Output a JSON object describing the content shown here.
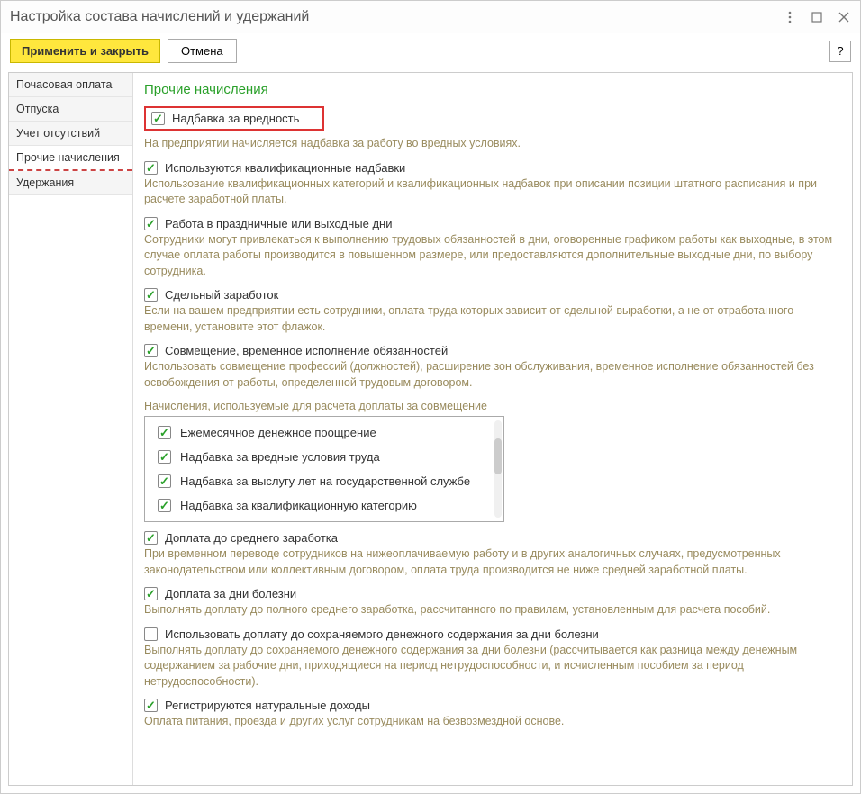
{
  "title": "Настройка состава начислений и удержаний",
  "toolbar": {
    "apply_close": "Применить и закрыть",
    "cancel": "Отмена",
    "help": "?"
  },
  "sidebar": {
    "items": [
      {
        "label": "Почасовая оплата"
      },
      {
        "label": "Отпуска"
      },
      {
        "label": "Учет отсутствий"
      },
      {
        "label": "Прочие начисления"
      },
      {
        "label": "Удержания"
      }
    ]
  },
  "section": {
    "title": "Прочие начисления"
  },
  "checks": {
    "hazard": {
      "label": "Надбавка за вредность",
      "checked": true
    },
    "hazard_desc": "На предприятии начисляется надбавка за работу во вредных условиях.",
    "qual": {
      "label": "Используются квалификационные надбавки",
      "checked": true
    },
    "qual_desc": "Использование квалификационных категорий и квалификационных надбавок при описании позиции штатного расписания и при расчете заработной платы.",
    "holiday": {
      "label": "Работа в праздничные или выходные дни",
      "checked": true
    },
    "holiday_desc": "Сотрудники могут привлекаться к выполнению трудовых обязанностей в дни, оговоренные графиком работы как выходные, в этом случае оплата работы производится в повышенном размере, или предоставляются дополнительные выходные дни, по выбору сотрудника.",
    "piece": {
      "label": "Сдельный заработок",
      "checked": true
    },
    "piece_desc": "Если на вашем предприятии есть сотрудники, оплата труда которых зависит от сдельной выработки, а не от отработанного времени, установите этот флажок.",
    "combine": {
      "label": "Совмещение, временное исполнение обязанностей",
      "checked": true
    },
    "combine_desc": "Использовать совмещение профессий (должностей), расширение зон обслуживания, временное исполнение обязанностей без освобождения от работы, определенной трудовым договором.",
    "combine_subhead": "Начисления, используемые для расчета доплаты за совмещение",
    "list": [
      {
        "label": "Ежемесячное денежное поощрение",
        "checked": true
      },
      {
        "label": "Надбавка за вредные условия труда",
        "checked": true
      },
      {
        "label": "Надбавка за выслугу лет на государственной службе",
        "checked": true
      },
      {
        "label": "Надбавка за квалификационную категорию",
        "checked": true
      }
    ],
    "avg": {
      "label": "Доплата до среднего заработка",
      "checked": true
    },
    "avg_desc": "При временном переводе сотрудников на нижеоплачиваемую работу и в других аналогичных случаях, предусмотренных законодательством или коллективным договором, оплата труда производится не ниже средней заработной платы.",
    "sick": {
      "label": "Доплата за дни болезни",
      "checked": true
    },
    "sick_desc": "Выполнять доплату до полного среднего заработка, рассчитанного по правилам, установленным для расчета пособий.",
    "sick_keep": {
      "label": "Использовать доплату до сохраняемого денежного содержания за дни болезни",
      "checked": false
    },
    "sick_keep_desc": "Выполнять доплату до сохраняемого денежного содержания за дни болезни (рассчитывается как разница между денежным содержанием за рабочие дни, приходящиеся на период нетрудоспособности, и исчисленным пособием за период нетрудоспособности).",
    "natural": {
      "label": "Регистрируются натуральные доходы",
      "checked": true
    },
    "natural_desc": "Оплата питания, проезда и других услуг сотрудникам на безвозмездной основе."
  }
}
